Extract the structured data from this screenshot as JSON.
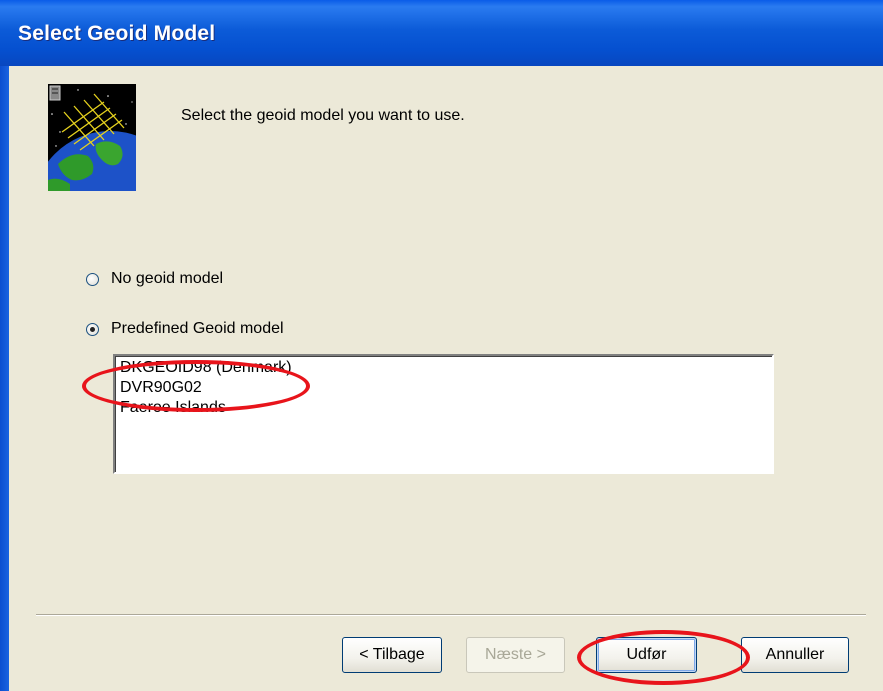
{
  "window": {
    "title": "Select Geoid Model"
  },
  "header": {
    "instruction": "Select the geoid model you want to use.",
    "logo_icon": "satellite-earth-icon"
  },
  "options": [
    {
      "label": "No geoid model",
      "selected": false
    },
    {
      "label": "Predefined Geoid model",
      "selected": true
    }
  ],
  "geoid_list": {
    "items": [
      "DKGEOID98 (Denmark)",
      "DVR90G02",
      "Faeroe Islands"
    ]
  },
  "buttons": {
    "back": "< Tilbage",
    "next": "Næste >",
    "finish": "Udfør",
    "cancel": "Annuller"
  },
  "colors": {
    "titlebar": "#0a5ce8",
    "annotation": "#e8141b",
    "dialog_bg": "#ece9d8"
  }
}
